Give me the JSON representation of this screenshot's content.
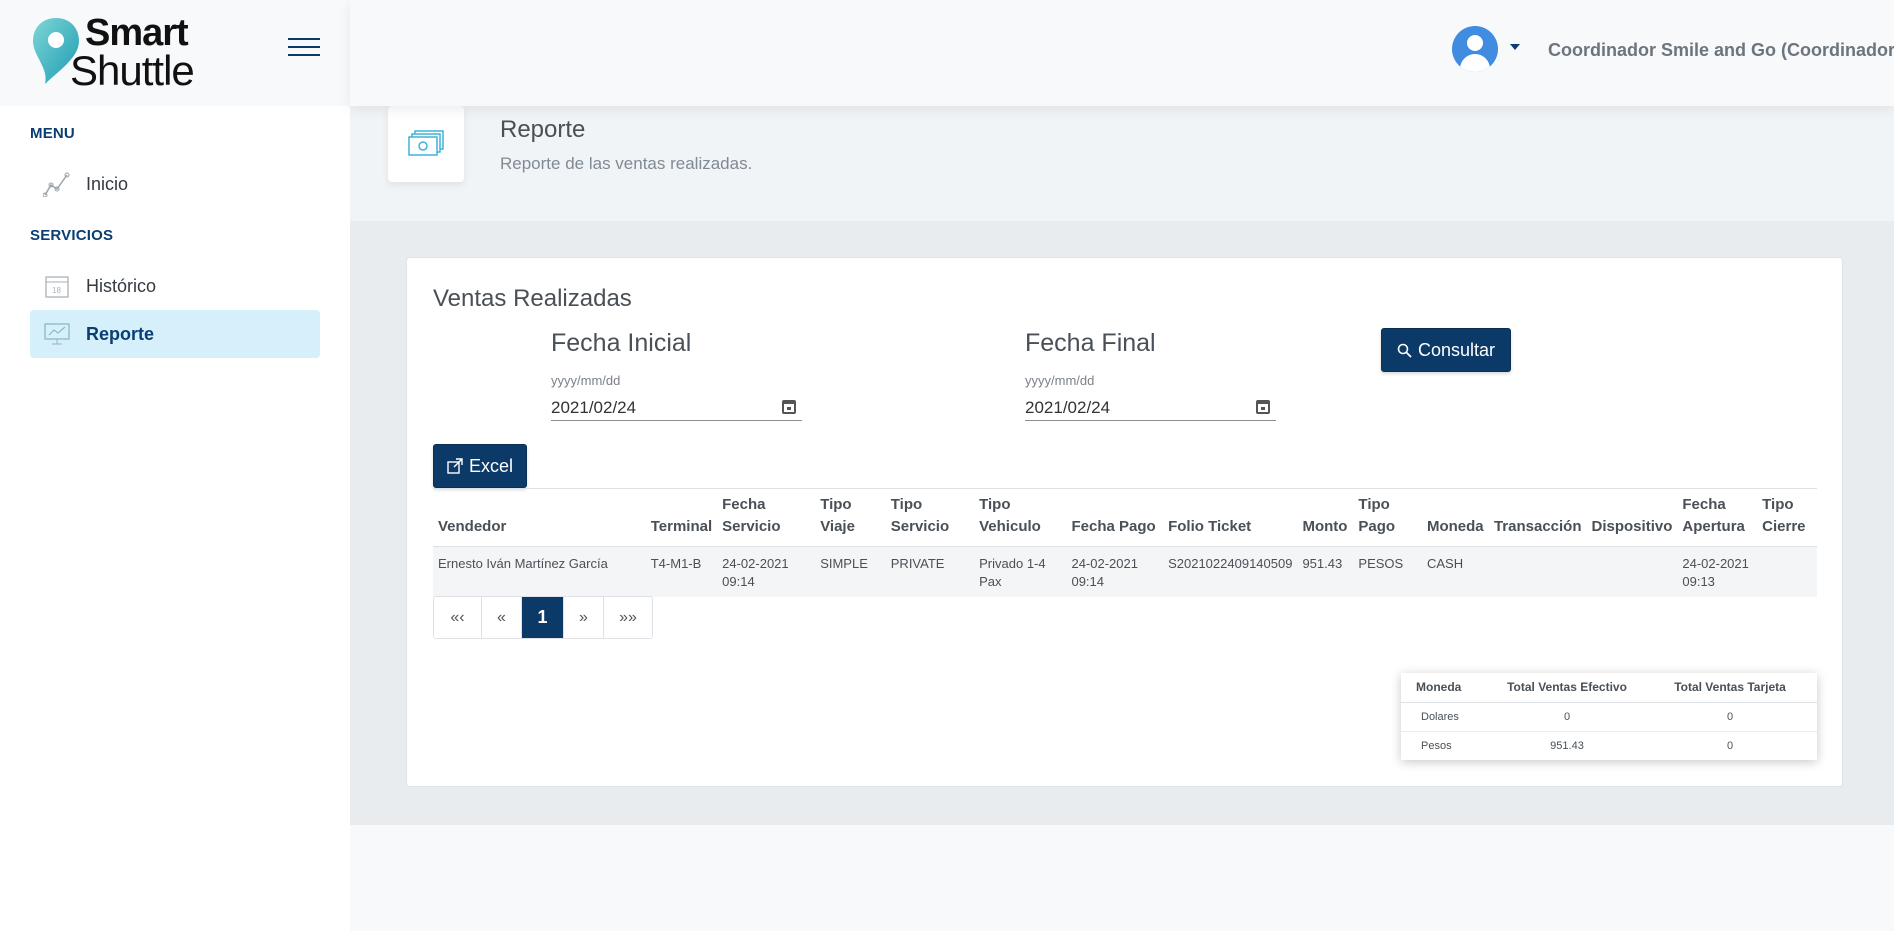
{
  "brand": {
    "line1": "Smart",
    "line2": "Shuttle"
  },
  "header": {
    "user_name": "Coordinador Smile and Go (Coordinador)"
  },
  "sidebar": {
    "menu_header": "MENU",
    "services_header": "SERVICIOS",
    "items": [
      {
        "label": "Inicio",
        "icon": "chart-line-icon"
      },
      {
        "label": "Histórico",
        "icon": "calendar-icon"
      },
      {
        "label": "Reporte",
        "icon": "presentation-chart-icon",
        "active": true
      }
    ]
  },
  "page": {
    "title": "Reporte",
    "subtitle": "Reporte de las ventas realizadas.",
    "icon": "cash-icon"
  },
  "card": {
    "title": "Ventas Realizadas",
    "start": {
      "label": "Fecha Inicial",
      "hint": "yyyy/mm/dd",
      "value": "2021/02/24"
    },
    "end": {
      "label": "Fecha Final",
      "hint": "yyyy/mm/dd",
      "value": "2021/02/24"
    },
    "consult_label": "Consultar",
    "excel_label": "Excel"
  },
  "table": {
    "headers": [
      [
        "Vendedor"
      ],
      [
        "Terminal"
      ],
      [
        "Fecha",
        "Servicio"
      ],
      [
        "Tipo",
        "Viaje"
      ],
      [
        "Tipo",
        "Servicio"
      ],
      [
        "Tipo",
        "Vehiculo"
      ],
      [
        "Fecha Pago"
      ],
      [
        "Folio Ticket"
      ],
      [
        "Monto"
      ],
      [
        "Tipo",
        "Pago"
      ],
      [
        "Moneda"
      ],
      [
        "Transacción"
      ],
      [
        "Dispositivo"
      ],
      [
        "Fecha",
        "Apertura"
      ],
      [
        "Tipo",
        "Cierre"
      ]
    ],
    "rows": [
      [
        [
          "Ernesto Iván Martínez García"
        ],
        [
          "T4-M1-B"
        ],
        [
          "24-02-2021",
          "09:14"
        ],
        [
          "SIMPLE"
        ],
        [
          "PRIVATE"
        ],
        [
          "Privado 1-4",
          "Pax"
        ],
        [
          "24-02-2021",
          "09:14"
        ],
        [
          "S2021022409140509"
        ],
        [
          "951.43"
        ],
        [
          "PESOS"
        ],
        [
          "CASH"
        ],
        [
          ""
        ],
        [
          ""
        ],
        [
          "24-02-2021",
          "09:13"
        ],
        [
          ""
        ]
      ]
    ]
  },
  "pagination": {
    "first": "«‹",
    "prev": "«",
    "current": "1",
    "next": "»",
    "last": "»»"
  },
  "summary": {
    "headers": [
      "Moneda",
      "Total Ventas Efectivo",
      "Total Ventas Tarjeta"
    ],
    "rows": [
      [
        "Dolares",
        "0",
        "0"
      ],
      [
        "Pesos",
        "951.43",
        "0"
      ]
    ]
  },
  "colors": {
    "primary": "#0b3a69",
    "active_bg": "#d5f0fb",
    "accent": "#3f8ce0"
  }
}
